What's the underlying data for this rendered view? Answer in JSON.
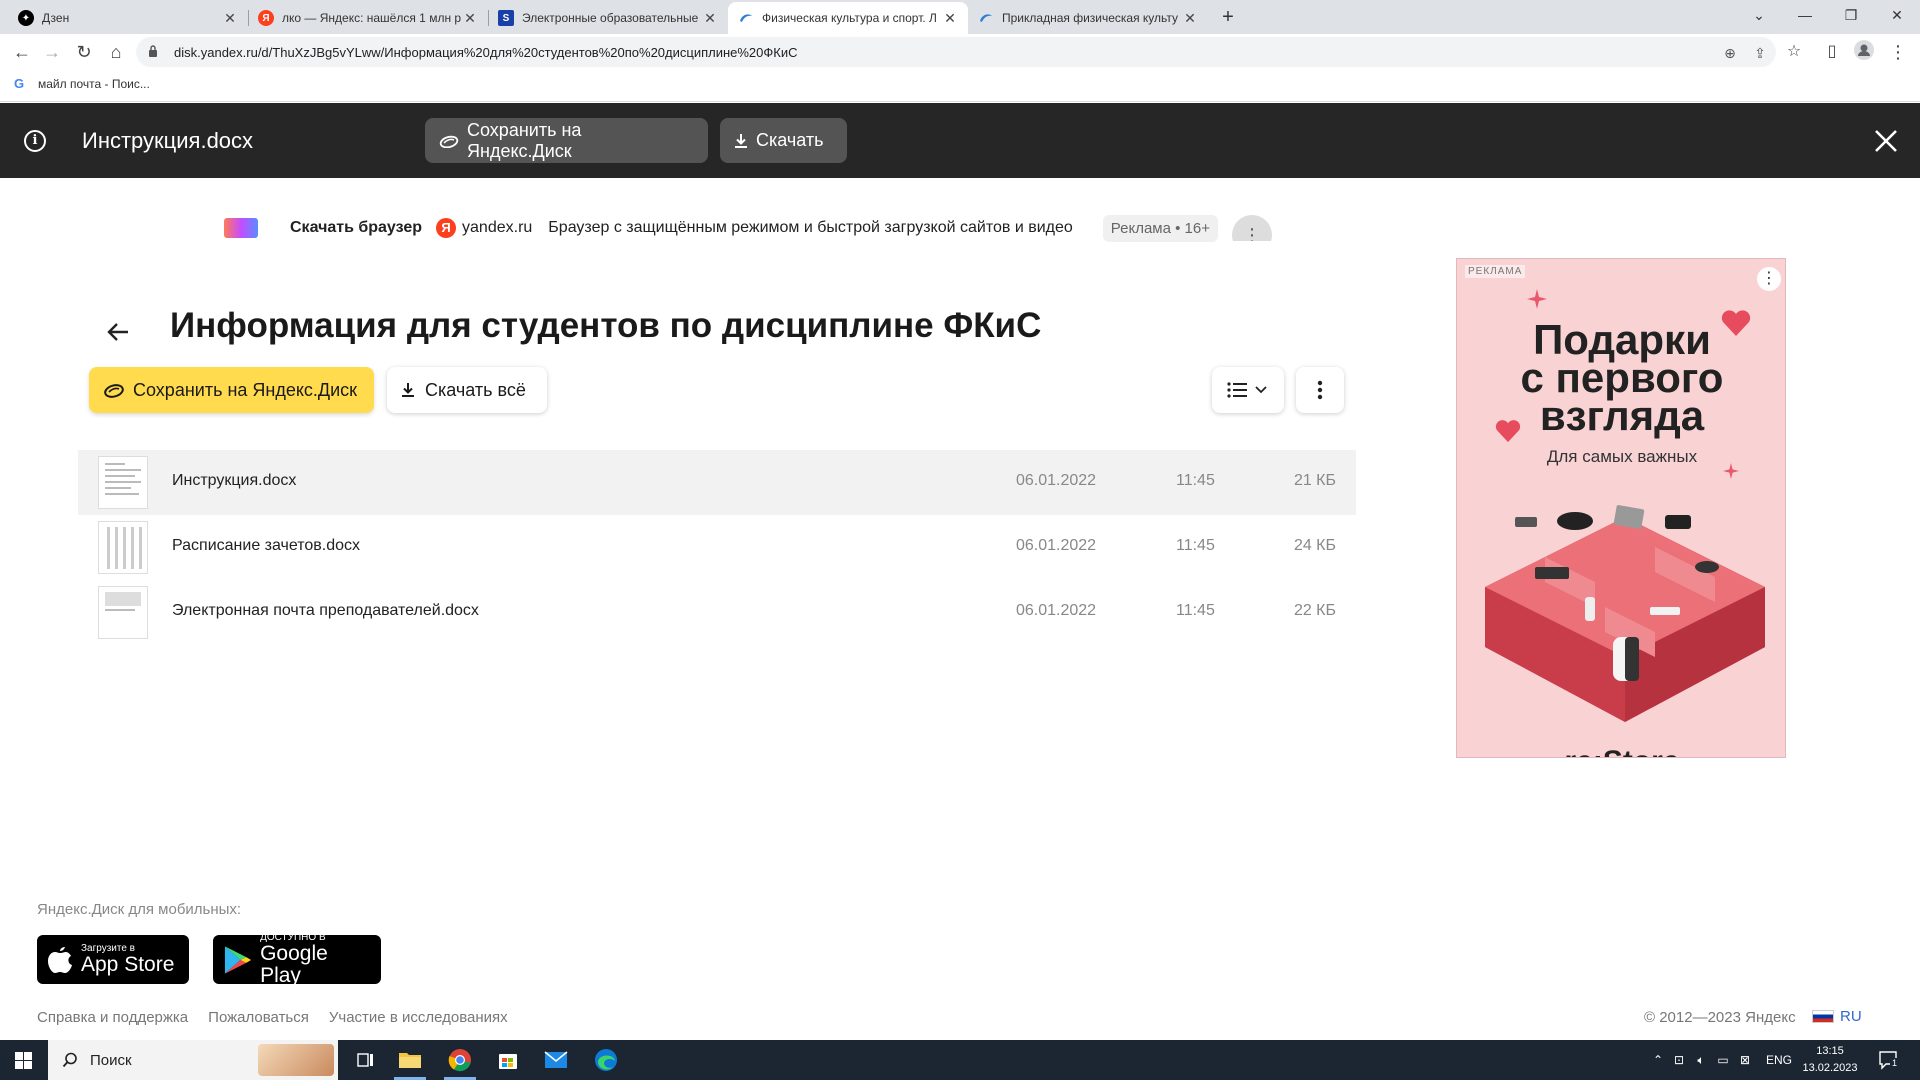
{
  "browser": {
    "tabs": [
      {
        "title": "Дзен",
        "favicon": "dzen-icon",
        "color": "#000000"
      },
      {
        "title": "лко — Яндекс: нашёлся 1 млн р",
        "favicon": "yandex-icon",
        "color": "#fc3f1d"
      },
      {
        "title": "Электронные образовательные",
        "favicon": "s-icon",
        "color": "#1a3fa8"
      },
      {
        "title": "Физическая культура и спорт. Л",
        "favicon": "disk-icon",
        "color": "#2f7ed8",
        "active": true
      },
      {
        "title": "Прикладная физическая культу",
        "favicon": "disk-icon",
        "color": "#2f7ed8"
      }
    ],
    "url": "disk.yandex.ru/d/ThuXzJBg5vYLww/Информация%20для%20студентов%20по%20дисциплине%20ФКиС",
    "bookmarks": [
      {
        "label": "майл почта - Поис..."
      }
    ]
  },
  "viewer": {
    "file_title": "Инструкция.docx",
    "save_label": "Сохранить на Яндекс.Диск",
    "download_label": "Скачать"
  },
  "top_ad": {
    "title": "Скачать браузер",
    "site": "yandex.ru",
    "text": "Браузер с защищённым режимом и быстрой загрузкой сайтов и видео",
    "label": "Реклама • 16+"
  },
  "folder": {
    "title": "Информация для студентов по дисциплине ФКиС",
    "save_label": "Сохранить на Яндекс.Диск",
    "download_all_label": "Скачать всё",
    "files": [
      {
        "name": "Инструкция.docx",
        "date": "06.01.2022",
        "time": "11:45",
        "size": "21 КБ",
        "selected": true
      },
      {
        "name": "Расписание зачетов.docx",
        "date": "06.01.2022",
        "time": "11:45",
        "size": "24 КБ"
      },
      {
        "name": "Электронная почта преподавателей.docx",
        "date": "06.01.2022",
        "time": "11:45",
        "size": "22 КБ"
      }
    ]
  },
  "side_ad": {
    "tag": "РЕКЛАМА",
    "headline_lines": [
      "Подарки",
      "с первого",
      "взгляда"
    ],
    "subline": "Для самых важных",
    "brand": "re:Store"
  },
  "footer": {
    "mobile_label": "Яндекс.Диск для мобильных:",
    "app_store": {
      "small": "Загрузите в",
      "big": "App Store"
    },
    "google_play": {
      "small": "ДОСТУПНО В",
      "big": "Google Play"
    },
    "links": [
      "Справка и поддержка",
      "Пожаловаться",
      "Участие в исследованиях"
    ],
    "copyright": "© 2012—2023 Яндекс",
    "language": "RU"
  },
  "taskbar": {
    "search_placeholder": "Поиск",
    "lang": "ENG",
    "time": "13:15",
    "date": "13.02.2023",
    "notifications": "1"
  },
  "colors": {
    "accent_yellow": "#ffdb4d",
    "viewer_bg": "#262626",
    "side_ad_bg": "#f9d2d4"
  }
}
